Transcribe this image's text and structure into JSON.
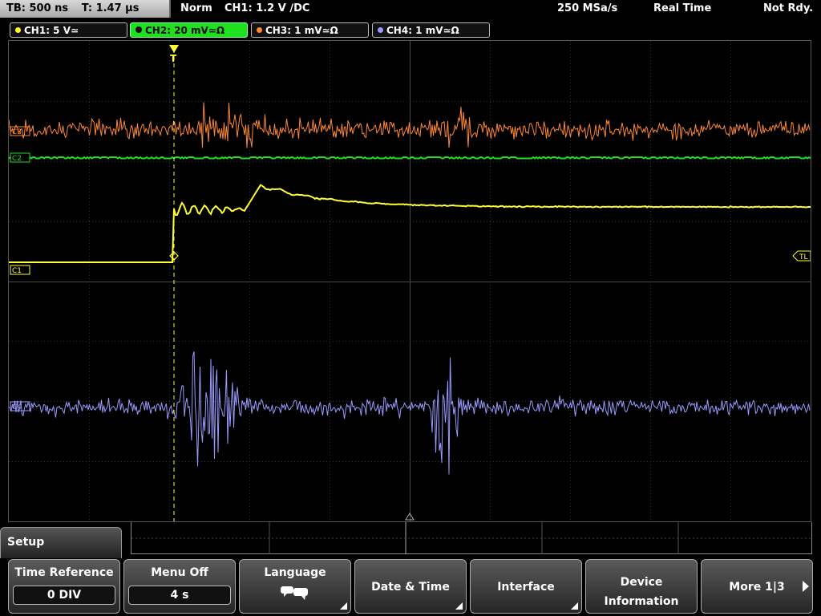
{
  "top_bar": {
    "timebase": "TB: 500 ns",
    "trigger_time": "T: 1.47 µs",
    "mode": "Norm",
    "trigger": "CH1: 1.2 V ∕DC",
    "sample_rate": "250 MSa/s",
    "acq_mode": "Real Time",
    "status": "Not Rdy."
  },
  "channels": [
    {
      "label": "CH1: 5 V≃",
      "color": "#ffff33"
    },
    {
      "label": "CH2: 20 mV≃Ω",
      "color": "#22dd22"
    },
    {
      "label": "CH3: 1 mV≃Ω",
      "color": "#ff8833"
    },
    {
      "label": "CH4: 1 mV≃Ω",
      "color": "#9a9aff"
    }
  ],
  "markers": {
    "ch1": "C1",
    "ch2": "C2",
    "ch3": "C3",
    "ch4": "C4",
    "trigger_level": "TL",
    "trigger_pos": "T"
  },
  "setup_tab": "Setup",
  "softkeys": [
    {
      "label": "Time Reference",
      "value": "0 DIV"
    },
    {
      "label": "Menu Off",
      "value": "4 s"
    },
    {
      "label": "Language"
    },
    {
      "label": "Date & Time"
    },
    {
      "label": "Interface"
    },
    {
      "label": "Device",
      "label2": "Information"
    },
    {
      "label": "More 1|3"
    }
  ]
}
